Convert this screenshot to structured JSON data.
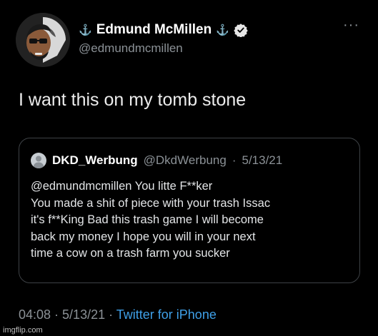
{
  "author": {
    "name": "Edmund McMillen",
    "handle": "@edmundmcmillen",
    "prefix_icon": "anchor",
    "suffix_icon": "anchor",
    "verified_icon": "verified-badge"
  },
  "more_icon": "more-dots-icon",
  "tweet": {
    "text": "I want this on my tomb stone"
  },
  "quoted": {
    "name": "DKD_Werbung",
    "handle": "@DkdWerbung",
    "separator": "·",
    "date": "5/13/21",
    "lines": [
      "@edmundmcmillen You litte F**ker",
      "You made a shit of piece with your trash Issac",
      "it's f**King Bad this trash game I will become",
      "back my money I hope you will in your next",
      "time a cow on a trash farm you sucker"
    ]
  },
  "meta": {
    "time": "04:08",
    "sep1": " · ",
    "date": "5/13/21",
    "sep2": " · ",
    "source": "Twitter for iPhone"
  },
  "watermark": "imgflip.com",
  "colors": {
    "background": "#000000",
    "link": "#3fa0e8",
    "muted": "#8b9196",
    "border": "#3e4246"
  }
}
